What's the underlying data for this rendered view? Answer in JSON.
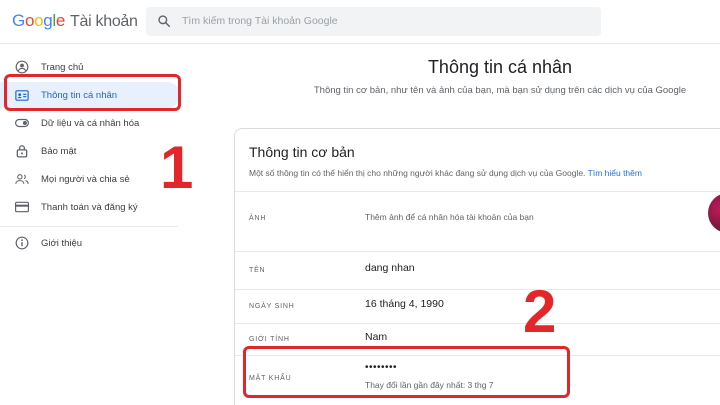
{
  "header": {
    "logo_google": [
      "G",
      "o",
      "o",
      "g",
      "l",
      "e"
    ],
    "logo_product": "Tài khoản",
    "search_placeholder": "Tìm kiếm trong Tài khoản Google"
  },
  "sidebar": {
    "items": [
      {
        "label": "Trang chủ",
        "icon": "home-person-icon"
      },
      {
        "label": "Thông tin cá nhân",
        "icon": "id-card-icon"
      },
      {
        "label": "Dữ liệu và cá nhân hóa",
        "icon": "toggle-icon"
      },
      {
        "label": "Bảo mật",
        "icon": "lock-icon"
      },
      {
        "label": "Mọi người và chia sẻ",
        "icon": "people-icon"
      },
      {
        "label": "Thanh toán và đăng ký",
        "icon": "credit-card-icon"
      },
      {
        "label": "Giới thiệu",
        "icon": "info-icon"
      }
    ],
    "active_index": 1
  },
  "main": {
    "title": "Thông tin cá nhân",
    "subtitle": "Thông tin cơ bản, như tên và ảnh của bạn, mà bạn sử dụng trên các dịch vụ của Google",
    "card": {
      "title": "Thông tin cơ bản",
      "description": "Một số thông tin có thể hiển thị cho những người khác đang sử dụng dịch vụ của Google.",
      "learn_more": "Tìm hiểu thêm",
      "rows": [
        {
          "label": "ẢNH",
          "value": "Thêm ảnh để cá nhân hóa tài khoản của bạn"
        },
        {
          "label": "TÊN",
          "value": "dang nhan"
        },
        {
          "label": "NGÀY SINH",
          "value": "16 tháng 4, 1990"
        },
        {
          "label": "GIỚI TÍNH",
          "value": "Nam"
        },
        {
          "label": "MẬT KHẨU",
          "value": "••••••••",
          "sub": "Thay đổi lần gần đây nhất: 3 thg 7"
        }
      ]
    }
  },
  "annotations": {
    "step1": "1",
    "step2": "2",
    "color": "#e3262a"
  },
  "colors": {
    "accent": "#1a73e8",
    "active_bg": "#e8f0fe",
    "active_text": "#1967d2"
  }
}
